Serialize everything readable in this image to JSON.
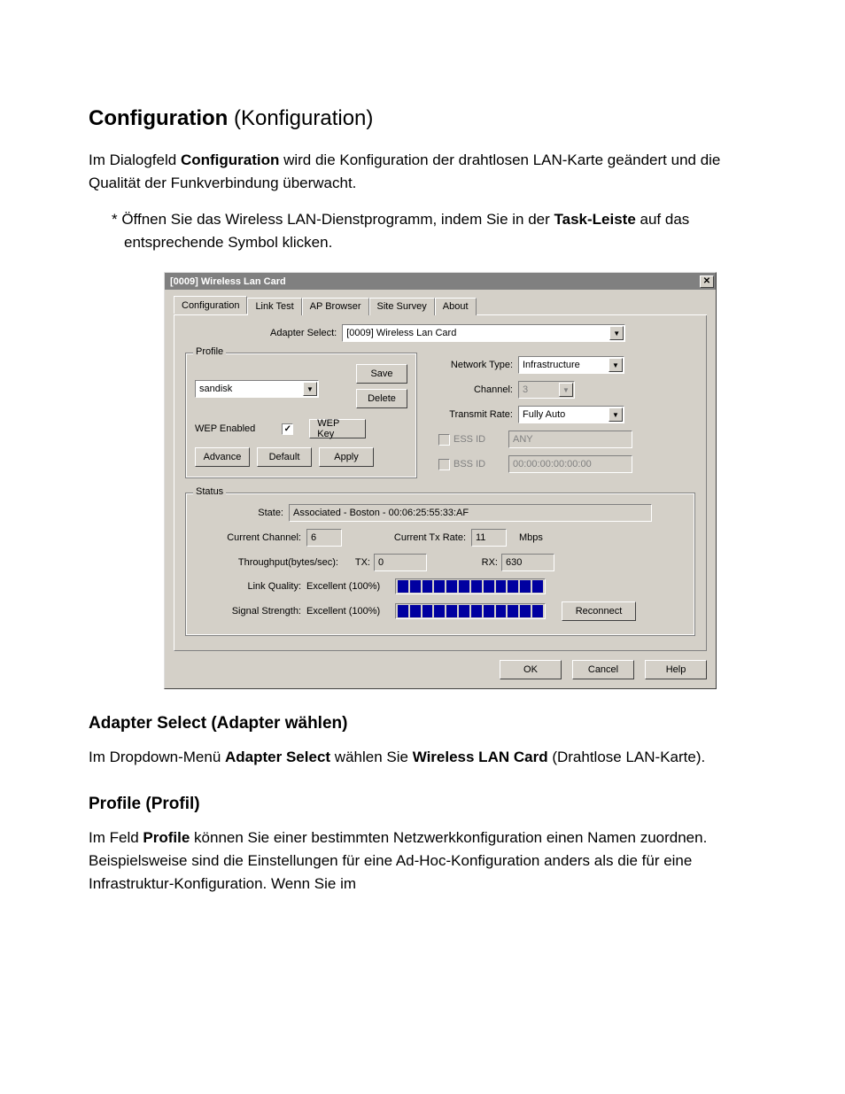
{
  "page": {
    "title_bold": "Configuration",
    "title_rest": " (Konfiguration)",
    "intro_pre": "Im Dialogfeld ",
    "intro_bold": "Configuration",
    "intro_post": " wird die Konfiguration der drahtlosen LAN-Karte geändert und die Qualität der Funkverbindung überwacht.",
    "bullet_pre": "* Öffnen Sie das Wireless LAN-Dienstprogramm, indem Sie in der ",
    "bullet_bold": "Task-Leiste",
    "bullet_post": " auf das entsprechende Symbol klicken.",
    "h2_adapter": "Adapter Select (Adapter wählen)",
    "adapter_p_pre": "Im Dropdown-Menü ",
    "adapter_p_b1": "Adapter Select",
    "adapter_p_mid": " wählen Sie ",
    "adapter_p_b2": "Wireless LAN Card",
    "adapter_p_post": " (Drahtlose LAN-Karte).",
    "h2_profile": "Profile (Profil)",
    "profile_p_pre": "Im Feld ",
    "profile_p_b": "Profile",
    "profile_p_post": " können Sie einer bestimmten Netzwerkkonfiguration einen Namen zuordnen. Beispielsweise sind die Einstellungen für eine Ad-Hoc-Konfiguration anders als die für eine Infrastruktur-Konfiguration. Wenn Sie im"
  },
  "dialog": {
    "title": "[0009] Wireless Lan Card",
    "tabs": [
      "Configuration",
      "Link Test",
      "AP Browser",
      "Site Survey",
      "About"
    ],
    "adapter_select_label": "Adapter Select:",
    "adapter_select_value": "[0009] Wireless Lan Card",
    "profile_legend": "Profile",
    "profile_value": "sandisk",
    "save_btn": "Save",
    "delete_btn": "Delete",
    "wep_enabled_label": "WEP Enabled",
    "wep_key_btn": "WEP Key",
    "advance_btn": "Advance",
    "default_btn": "Default",
    "apply_btn": "Apply",
    "network_type_label": "Network Type:",
    "network_type_value": "Infrastructure",
    "channel_label": "Channel:",
    "channel_value": "3",
    "transmit_rate_label": "Transmit Rate:",
    "transmit_rate_value": "Fully Auto",
    "ess_id_label": "ESS ID",
    "ess_id_value": "ANY",
    "bss_id_label": "BSS ID",
    "bss_id_value": "00:00:00:00:00:00",
    "status_legend": "Status",
    "state_label": "State:",
    "state_value": "Associated - Boston - 00:06:25:55:33:AF",
    "current_channel_label": "Current Channel:",
    "current_channel_value": "6",
    "current_tx_rate_label": "Current Tx Rate:",
    "current_tx_rate_value": "11",
    "mbps_label": "Mbps",
    "throughput_label": "Throughput(bytes/sec):",
    "tx_label": "TX:",
    "tx_value": "0",
    "rx_label": "RX:",
    "rx_value": "630",
    "link_quality_label": "Link Quality:",
    "link_quality_value": "Excellent (100%)",
    "signal_strength_label": "Signal Strength:",
    "signal_strength_value": "Excellent (100%)",
    "reconnect_btn": "Reconnect",
    "ok_btn": "OK",
    "cancel_btn": "Cancel",
    "help_btn": "Help"
  }
}
